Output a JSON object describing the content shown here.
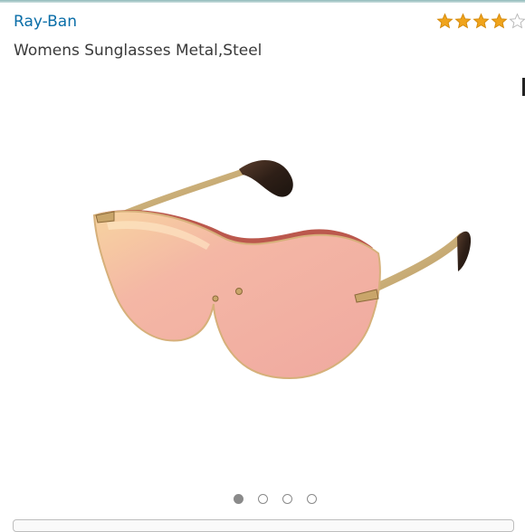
{
  "product": {
    "brand": "Ray-Ban",
    "title": "Womens Sunglasses Metal,Steel",
    "rating_stars_filled": 4,
    "rating_stars_total": 5
  },
  "colors": {
    "brand_link": "#0a6ea8",
    "star_fill": "#f0a41c",
    "lens_tint": "#f2b2a7",
    "frame_gold": "#c9ad78"
  },
  "carousel": {
    "image_count": 4,
    "active_index": 0
  }
}
